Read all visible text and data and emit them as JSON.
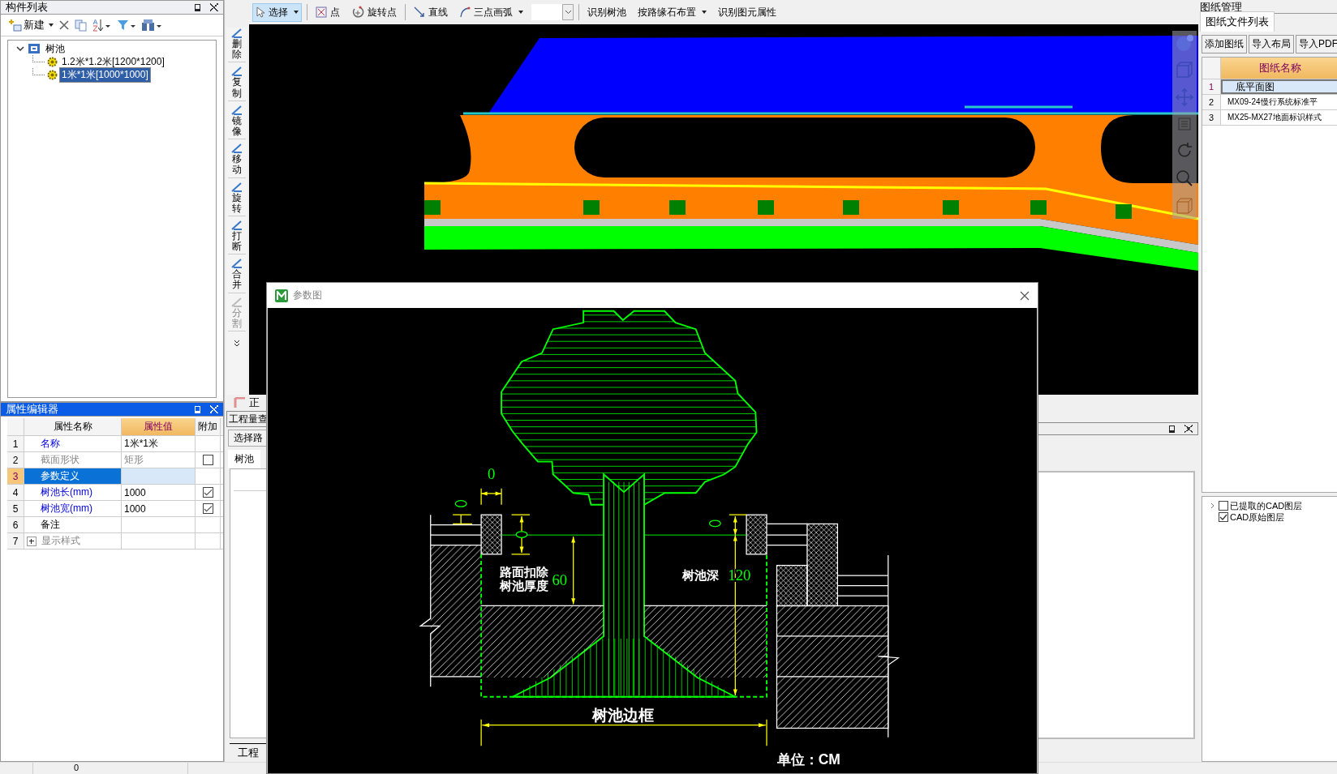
{
  "component_list": {
    "title": "构件列表",
    "new_label": "新建",
    "tree": [
      {
        "label": "树池",
        "expanded": true,
        "children": [
          {
            "label": "1.2米*1.2米[1200*1200]",
            "selected": false
          },
          {
            "label": "1米*1米[1000*1000]",
            "selected": true
          }
        ]
      }
    ]
  },
  "edit_tools": [
    {
      "label": "删除",
      "disabled": false
    },
    {
      "label": "复制",
      "disabled": false
    },
    {
      "label": "镜像",
      "disabled": false
    },
    {
      "label": "移动",
      "disabled": false
    },
    {
      "label": "旋转",
      "disabled": false
    },
    {
      "label": "打断",
      "disabled": false
    },
    {
      "label": "合并",
      "disabled": false
    },
    {
      "label": "分割",
      "disabled": true
    }
  ],
  "toolbar": [
    {
      "kind": "pointer",
      "label": "选择",
      "selected": true,
      "dropdown": true
    },
    {
      "kind": "separator"
    },
    {
      "kind": "point",
      "label": "点",
      "selected": false,
      "dropdown": false
    },
    {
      "kind": "rotate",
      "label": "旋转点",
      "selected": false,
      "dropdown": false
    },
    {
      "kind": "separator"
    },
    {
      "kind": "line",
      "label": "直线",
      "selected": false,
      "dropdown": false
    },
    {
      "kind": "arc",
      "label": "三点画弧",
      "selected": false,
      "dropdown": true
    },
    {
      "kind": "combo"
    },
    {
      "kind": "separator"
    },
    {
      "kind": "text",
      "label": "识别树池",
      "selected": false,
      "dropdown": false
    },
    {
      "kind": "text",
      "label": "按路缘石布置",
      "selected": false,
      "dropdown": true
    },
    {
      "kind": "text",
      "label": "识别图元属性",
      "selected": false,
      "dropdown": false
    }
  ],
  "property_editor": {
    "title": "属性编辑器",
    "columns": [
      "属性名称",
      "属性值",
      "附加"
    ],
    "rows": [
      {
        "num": "1",
        "name": "名称",
        "value": "1米*1米",
        "kind": "param",
        "disabled": false,
        "selected": false
      },
      {
        "num": "2",
        "name": "截面形状",
        "value": "矩形",
        "kind": "plain",
        "disabled": true,
        "selected": false,
        "checked": false
      },
      {
        "num": "3",
        "name": "参数定义",
        "kind": "param",
        "disabled": false,
        "selected": true
      },
      {
        "num": "4",
        "name": "树池长(mm)",
        "value": "1000",
        "kind": "param",
        "disabled": false,
        "selected": false,
        "checked": true
      },
      {
        "num": "5",
        "name": "树池宽(mm)",
        "value": "1000",
        "kind": "param",
        "disabled": false,
        "selected": false,
        "checked": true
      },
      {
        "num": "6",
        "name": "备注",
        "kind": "plain",
        "disabled": false,
        "selected": false
      },
      {
        "num": "7",
        "name": "显示样式",
        "kind": "plain",
        "disabled": true,
        "selected": false,
        "expanded": false
      }
    ]
  },
  "lower_panel": {
    "ortho_label": "正",
    "query_title": "工程量查",
    "select_label": "选择路",
    "tab": "树池",
    "bottom_label": "工程"
  },
  "drawing_manager": {
    "title": "图纸管理",
    "tab": "图纸文件列表",
    "buttons": [
      "添加图纸",
      "导入布局",
      "导入PDF"
    ],
    "column": "图纸名称",
    "rows": [
      {
        "num": "1",
        "name": "底平面图",
        "selected": true
      },
      {
        "num": "2",
        "name": "MX09-24慢行系统标准平",
        "selected": false
      },
      {
        "num": "3",
        "name": "MX25-MX27地面标识样式",
        "selected": false
      }
    ],
    "layers": [
      {
        "label": "已提取的CAD图层",
        "checked": false
      },
      {
        "label": "CAD原始图层",
        "checked": true
      }
    ]
  },
  "dialog": {
    "title": "参数图",
    "top_gap": "0",
    "deduct_label": [
      "路面扣除",
      "树池厚度"
    ],
    "deduct_value": "60",
    "depth_label": "树池深",
    "depth_value": "120",
    "frame_label": "树池边框",
    "unit": "单位：CM"
  },
  "status_bar": {
    "value": "0"
  }
}
